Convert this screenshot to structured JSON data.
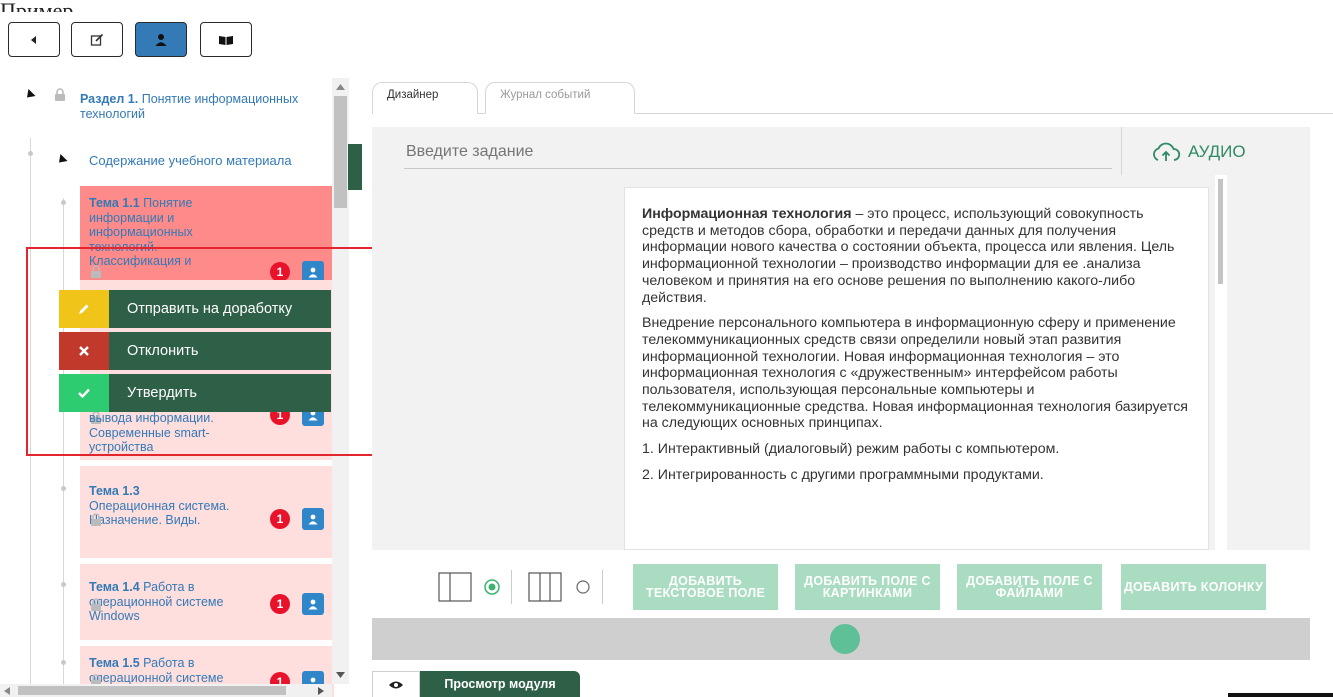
{
  "cropped_heading": "Пример",
  "toolbar": {
    "buttons": [
      {
        "name": "back-button",
        "icon": "caret-left-icon"
      },
      {
        "name": "edit-button",
        "icon": "edit-icon"
      },
      {
        "name": "user-button",
        "icon": "user-icon",
        "active": true
      },
      {
        "name": "book-button",
        "icon": "book-icon"
      }
    ]
  },
  "tree": {
    "section": {
      "prefix": "Раздел 1.",
      "title": "Понятие информационных технологий"
    },
    "subsection": {
      "title": "Содержание учебного материала"
    },
    "topics": [
      {
        "prefix": "Тема 1.1",
        "title": "Понятие информации и информационных технологий. Классификация и",
        "badge": "1",
        "state": "rejected"
      },
      {
        "prefix": "",
        "title": "вывода информации. Современные smart-устройства",
        "badge": "1",
        "state": "pending"
      },
      {
        "prefix": "Тема 1.3",
        "title": "Операционная система. Назначение. Виды.",
        "badge": "1",
        "state": "pending"
      },
      {
        "prefix": "Тема 1.4",
        "title": "Работа в операционной системе Windows",
        "badge": "1",
        "state": "pending"
      },
      {
        "prefix": "Тема 1.5",
        "title": "Работа в операционной системе",
        "badge": "1",
        "state": "pending"
      }
    ]
  },
  "context_menu": {
    "items": [
      {
        "label": "Отправить на доработку",
        "icon": "pencil-icon",
        "color": "#f0c419"
      },
      {
        "label": "Отклонить",
        "icon": "close-icon",
        "color": "#c0392b"
      },
      {
        "label": "Утвердить",
        "icon": "check-icon",
        "color": "#2ecc71"
      }
    ]
  },
  "tabs": [
    {
      "label": "Дизайнер",
      "active": true
    },
    {
      "label": "Журнал событий",
      "active": false
    }
  ],
  "task_input": {
    "placeholder": "Введите задание"
  },
  "audio_button": {
    "label": "АУДИО"
  },
  "document": {
    "p1_bold": "Информационная технология",
    "p1_rest": " – это процесс, использующий совокупность средств и методов сбора, обработки и передачи данных для получения информации нового качества о состоянии объекта, процесса или явления. Цель информационной технологии – производство информации для ее .анализа человеком и принятия на его основе решения по выполнению какого-либо действия.",
    "p2": "Внедрение персонального компьютера в информационную сферу и применение телекоммуникационных средств связи определили новый этап развития информационной технологии. Новая информационная технология – это информационная технология с «дружественным» интерфейсом работы пользователя, использующая персональные компьютеры и телекоммуникационные средства. Новая информационная технология базируется на следующих основных принципах.",
    "p3": "1. Интерактивный (диалоговый) режим работы с компьютером.",
    "p4": "2. Интегрированность с другими программными продуктами."
  },
  "layout_options": [
    {
      "name": "one-column",
      "selected": true
    },
    {
      "name": "three-column",
      "selected": false
    }
  ],
  "add_buttons": {
    "text_field": "ДОБАВИТЬ ТЕКСТОВОЕ ПОЛЕ",
    "image_field": "ДОБАВИТЬ ПОЛЕ С КАРТИНКАМИ",
    "file_field": "ДОБАВИТЬ ПОЛЕ С ФАЙЛАМИ",
    "column": "ДОБАВИТЬ КОЛОНКУ"
  },
  "bottom_tab": {
    "label": "Просмотр модуля"
  },
  "colors": {
    "accent": "#337ab7",
    "rejected_bg": "#ff8a8a",
    "pending_bg": "#ffdede",
    "menu_bg": "#2e6048",
    "green_button": "#a9dcc0",
    "highlight_frame": "#e3262e"
  }
}
